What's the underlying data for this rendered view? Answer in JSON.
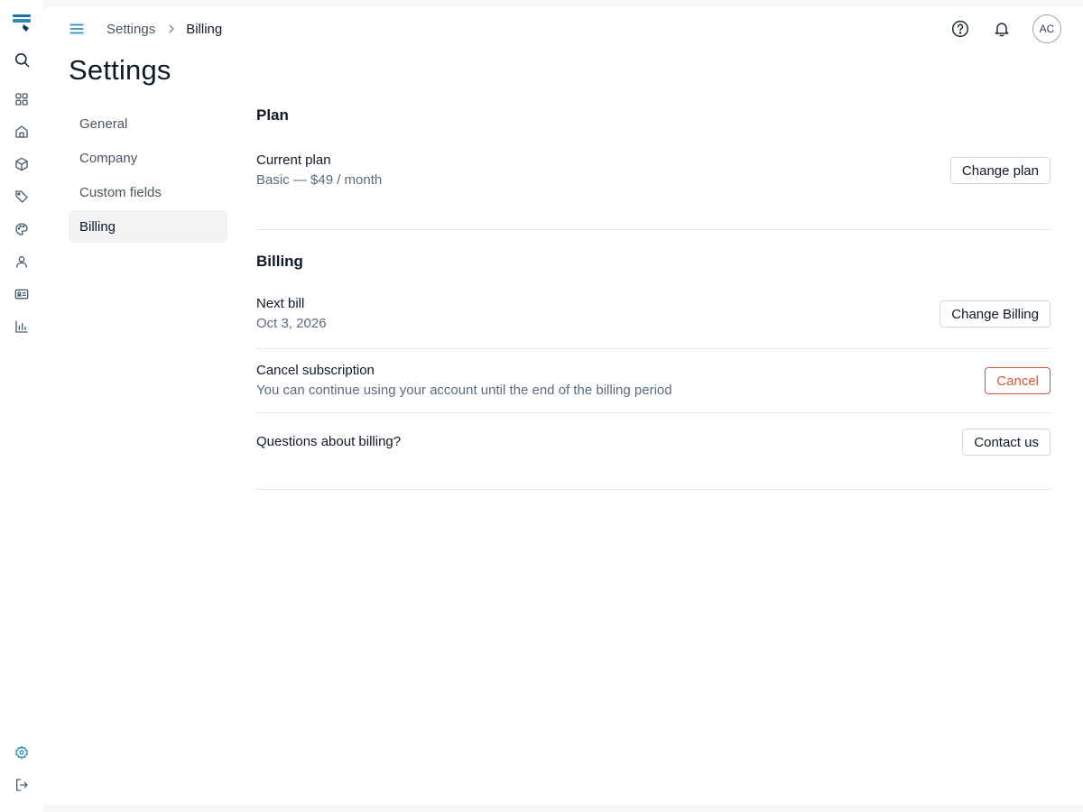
{
  "breadcrumb": {
    "parent": "Settings",
    "current": "Billing"
  },
  "header": {
    "avatar_initials": "AC"
  },
  "page": {
    "title": "Settings"
  },
  "settings_nav": {
    "items": [
      {
        "label": "General",
        "active": false
      },
      {
        "label": "Company",
        "active": false
      },
      {
        "label": "Custom fields",
        "active": false
      },
      {
        "label": "Billing",
        "active": true
      }
    ]
  },
  "plan": {
    "heading": "Plan",
    "current_plan_label": "Current plan",
    "current_plan_value": "Basic — $49 / month",
    "change_plan_label": "Change plan"
  },
  "billing": {
    "heading": "Billing",
    "next_bill_label": "Next bill",
    "next_bill_value": "Oct 3, 2026",
    "change_billing_label": "Change Billing",
    "cancel_label": "Cancel subscription",
    "cancel_description": "You can continue using your account until the end of the billing period",
    "cancel_button_label": "Cancel",
    "questions_label": "Questions about billing?",
    "contact_button_label": "Contact us"
  },
  "rail_icons": [
    "logo-icon",
    "search-icon",
    "grid-icon",
    "home-icon",
    "box-icon",
    "tag-icon",
    "palette-icon",
    "user-icon",
    "id-card-icon",
    "bar-chart-icon",
    "gear-icon",
    "logout-icon"
  ],
  "colors": {
    "accent": "#2b8fb7",
    "danger": "#d9533a",
    "brand": "#1e6fa8"
  }
}
